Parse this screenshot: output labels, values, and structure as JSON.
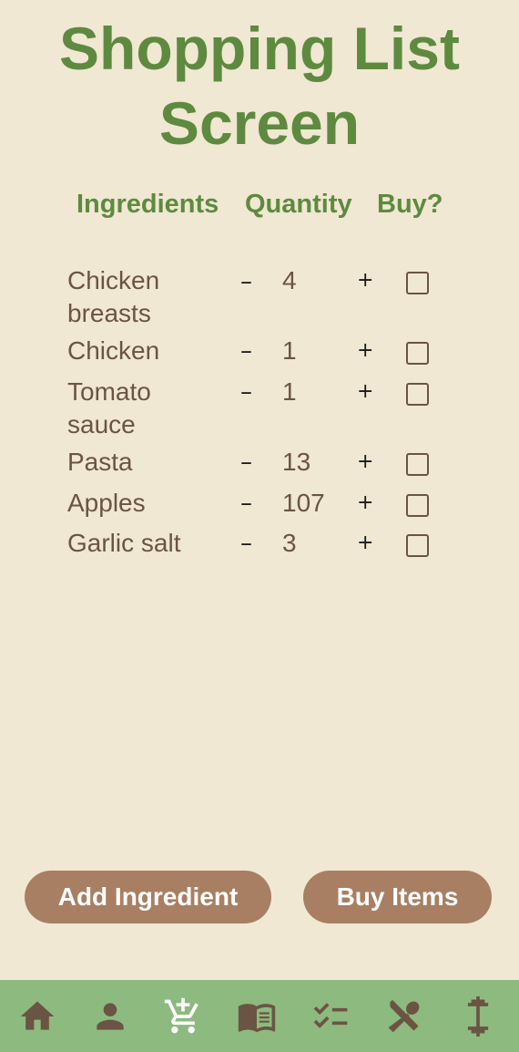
{
  "screen": {
    "title": "Shopping List Screen"
  },
  "columns": {
    "ingredients": "Ingredients",
    "quantity": "Quantity",
    "buy": "Buy?"
  },
  "controls": {
    "minus": "–",
    "plus": "+"
  },
  "items": [
    {
      "name": "Chicken breasts",
      "quantity": "4",
      "checked": false
    },
    {
      "name": "Chicken",
      "quantity": "1",
      "checked": false
    },
    {
      "name": "Tomato sauce",
      "quantity": "1",
      "checked": false
    },
    {
      "name": "Pasta",
      "quantity": "13",
      "checked": false
    },
    {
      "name": "Apples",
      "quantity": "107",
      "checked": false
    },
    {
      "name": "Garlic salt",
      "quantity": "3",
      "checked": false
    }
  ],
  "actions": {
    "add_label": "Add Ingredient",
    "buy_label": "Buy Items"
  },
  "nav": [
    {
      "icon": "home-icon",
      "active": false
    },
    {
      "icon": "person-icon",
      "active": false
    },
    {
      "icon": "cart-add-icon",
      "active": true
    },
    {
      "icon": "book-icon",
      "active": false
    },
    {
      "icon": "checklist-icon",
      "active": false
    },
    {
      "icon": "utensils-icon",
      "active": false
    },
    {
      "icon": "dumbbell-icon",
      "active": false
    }
  ],
  "colors": {
    "background": "#f0e8d2",
    "title_green": "#5e8a40",
    "text_brown": "#6b5444",
    "button": "#a87f63",
    "navbar": "#8dba7f",
    "nav_icon": "#6b5444",
    "nav_icon_active": "#ffffff"
  }
}
